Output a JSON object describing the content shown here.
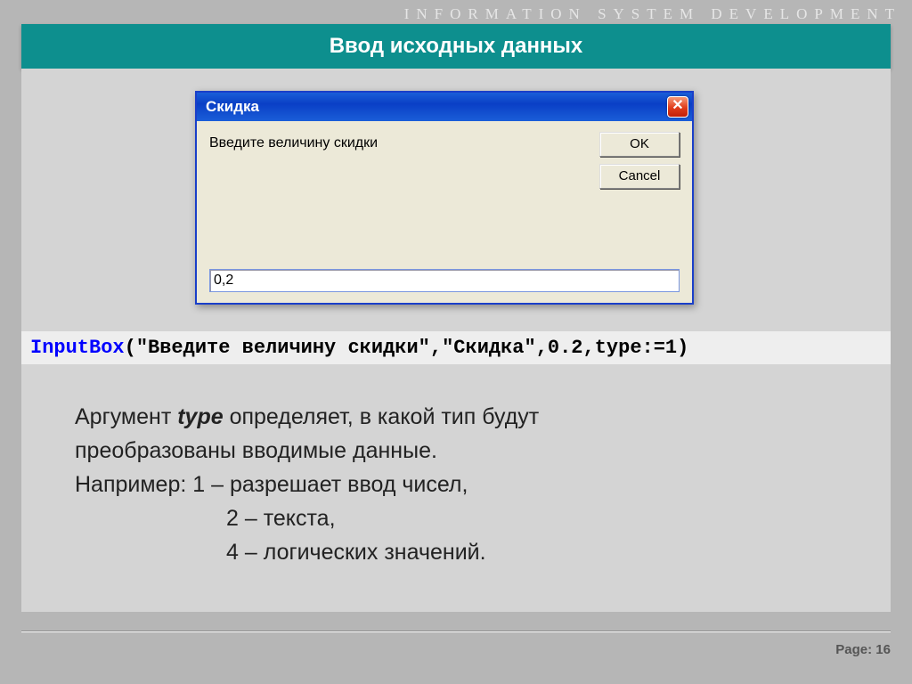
{
  "top_strip": "INFORMATION  SYSTEM   DEVELOPMENT",
  "slide_title": "Ввод исходных данных",
  "dialog": {
    "title": "Скидка",
    "prompt": "Введите величину скидки",
    "ok": "OK",
    "cancel": "Cancel",
    "input_value": "0,2",
    "close_glyph": "✕"
  },
  "code": {
    "fn": "InputBox",
    "rest": "(\"Введите величину скидки\",\"Скидка\",0.2,type:=1)"
  },
  "body": {
    "l1a": "Аргумент ",
    "l1kw": "type",
    "l1b": "  определяет, в какой тип будут",
    "l2": "преобразованы вводимые данные.",
    "l3": "Например:  1 – разрешает ввод чисел,",
    "l4": "2 – текста,",
    "l5": "4 – логических значений."
  },
  "footer": {
    "page": "Page: 16"
  }
}
